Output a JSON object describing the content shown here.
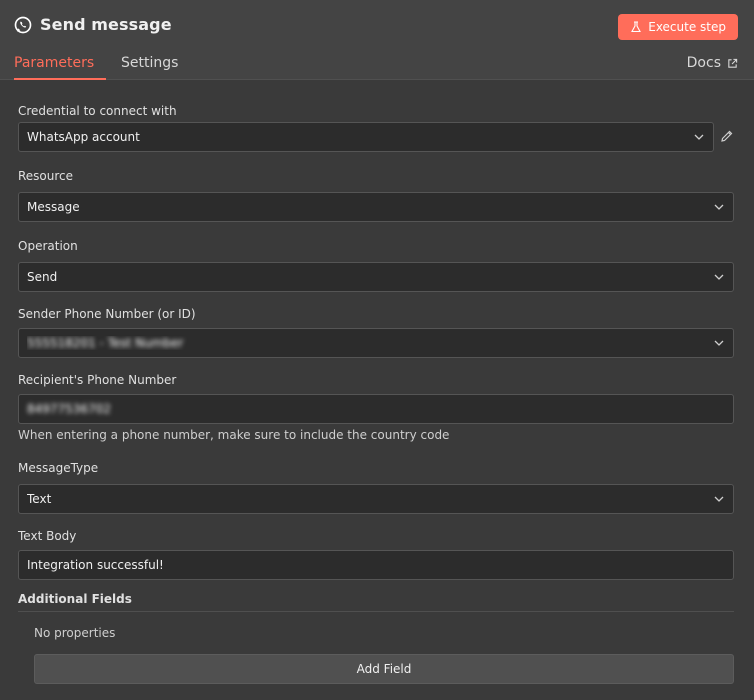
{
  "header": {
    "title": "Send message",
    "execute_label": "Execute step",
    "docs_label": "Docs",
    "accent_color": "#ff6d5a",
    "icon": "whatsapp-icon"
  },
  "tabs": [
    {
      "label": "Parameters",
      "active": true
    },
    {
      "label": "Settings",
      "active": false
    }
  ],
  "fields": {
    "credential": {
      "label": "Credential to connect with",
      "value": "WhatsApp account"
    },
    "resource": {
      "label": "Resource",
      "value": "Message"
    },
    "operation": {
      "label": "Operation",
      "value": "Send"
    },
    "sender": {
      "label": "Sender Phone Number (or ID)",
      "value": "555518201 - Test Number"
    },
    "recipient": {
      "label": "Recipient's Phone Number",
      "value": "84977536702",
      "hint": "When entering a phone number, make sure to include the country code"
    },
    "message_type": {
      "label": "MessageType",
      "value": "Text"
    },
    "text_body": {
      "label": "Text Body",
      "value": "Integration successful!"
    }
  },
  "additional_fields": {
    "label": "Additional Fields",
    "empty_text": "No properties",
    "add_label": "Add Field"
  }
}
